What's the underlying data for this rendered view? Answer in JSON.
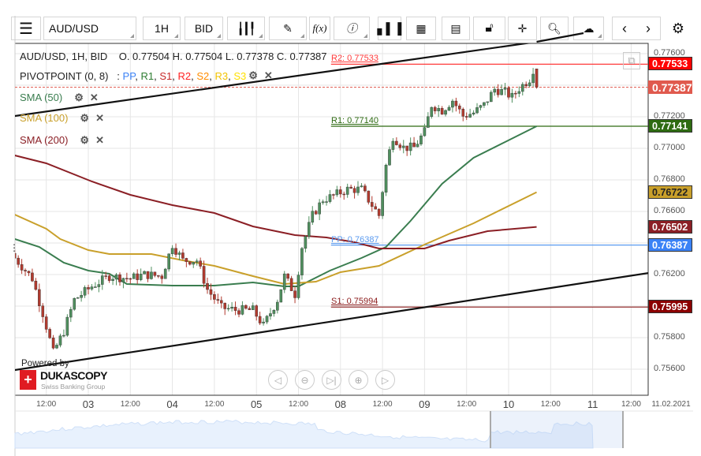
{
  "toolbar": {
    "instrument": "AUD/USD",
    "timeframe": "1H",
    "price_side": "BID",
    "items": [
      "menu-icon",
      "candlestick-icon",
      "pencil-icon",
      "function-icon",
      "info-icon",
      "bar-chart-icon",
      "calendar-icon",
      "report-icon",
      "lock-icon",
      "crosshair-icon",
      "zoom-icon",
      "cloud-upload-icon",
      "chevron-left-icon",
      "chevron-right-icon",
      "gear-icon"
    ],
    "fx_label": "f(x)"
  },
  "legend": {
    "header": "AUD/USD, 1H, BID",
    "ohlc": "O. 0.77504 H. 0.77504 L. 0.77378 C. 0.77387",
    "pivot": "PIVOTPOINT (0, 8)",
    "pivot_sep": ":",
    "pivot_parts": [
      {
        "label": "PP",
        "color": "#3b82f6"
      },
      {
        "label": "R1",
        "color": "#2e7d32"
      },
      {
        "label": "S1",
        "color": "#c62828"
      },
      {
        "label": "R2",
        "color": "#ff2222"
      },
      {
        "label": "S2",
        "color": "#ff8c00"
      },
      {
        "label": "R3",
        "color": "#f2c200"
      },
      {
        "label": "S3",
        "color": "#ffe000"
      }
    ],
    "sma": [
      {
        "label": "SMA (50)",
        "color": "#3a7d4f"
      },
      {
        "label": "SMA (100)",
        "color": "#c9a02b"
      },
      {
        "label": "SMA (200)",
        "color": "#8b1f25"
      }
    ]
  },
  "chart_data": {
    "type": "candlestick",
    "last_candle": {
      "time": "10 08:00",
      "open": 0.77504,
      "high": 0.77504,
      "low": 0.77378,
      "close": 0.77387
    },
    "price_path": [
      [
        "02 03:00",
        0.76305
      ],
      [
        "02 08:00",
        0.76175
      ],
      [
        "02 11:00",
        0.75955
      ],
      [
        "02 14:00",
        0.75705
      ],
      [
        "02 17:00",
        0.7584
      ],
      [
        "02 20:00",
        0.7604
      ],
      [
        "03 01:00",
        0.76125
      ],
      [
        "03 06:00",
        0.7619
      ],
      [
        "03 12:00",
        0.76175
      ],
      [
        "03 16:00",
        0.762
      ],
      [
        "03 21:00",
        0.7619
      ],
      [
        "04 00:00",
        0.7639
      ],
      [
        "04 03:00",
        0.7629
      ],
      [
        "04 07:00",
        0.7629
      ],
      [
        "04 10:00",
        0.76105
      ],
      [
        "04 14:00",
        0.7599
      ],
      [
        "04 18:00",
        0.75975
      ],
      [
        "04 23:00",
        0.75975
      ],
      [
        "05 02:00",
        0.75875
      ],
      [
        "05 06:00",
        0.7604
      ],
      [
        "05 08:00",
        0.7619
      ],
      [
        "05 11:00",
        0.76075
      ],
      [
        "05 13:00",
        0.76375
      ],
      [
        "05 16:00",
        0.76575
      ],
      [
        "05 19:00",
        0.76675
      ],
      [
        "05 21:00",
        0.7669
      ],
      [
        "08 02:00",
        0.7674
      ],
      [
        "08 06:00",
        0.7674
      ],
      [
        "08 09:00",
        0.7664
      ],
      [
        "08 11:00",
        0.76575
      ],
      [
        "08 13:00",
        0.7689
      ],
      [
        "08 15:00",
        0.77075
      ],
      [
        "08 18:00",
        0.77005
      ],
      [
        "08 21:00",
        0.77005
      ],
      [
        "09 00:00",
        0.77105
      ],
      [
        "09 02:00",
        0.77275
      ],
      [
        "09 05:00",
        0.7724
      ],
      [
        "09 08:00",
        0.77305
      ],
      [
        "09 11:00",
        0.77205
      ],
      [
        "09 14:00",
        0.77225
      ],
      [
        "09 17:00",
        0.77275
      ],
      [
        "09 20:00",
        0.77375
      ],
      [
        "09 23:00",
        0.77355
      ],
      [
        "10 01:00",
        0.77325
      ],
      [
        "10 03:00",
        0.7738
      ],
      [
        "10 06:00",
        0.7744
      ],
      [
        "10 07:00",
        0.775
      ]
    ],
    "sma": [
      {
        "name": "SMA (50)",
        "color": "#3a7d4f",
        "points": [
          [
            "02 03:00",
            0.76425
          ],
          [
            "02 10:00",
            0.76375
          ],
          [
            "02 17:00",
            0.76275
          ],
          [
            "03 00:00",
            0.76225
          ],
          [
            "03 06:00",
            0.76205
          ],
          [
            "03 11:00",
            0.7614
          ],
          [
            "04 00:00",
            0.7613
          ],
          [
            "04 12:00",
            0.7613
          ],
          [
            "04 23:00",
            0.7615
          ],
          [
            "05 08:00",
            0.76125
          ],
          [
            "05 12:00",
            0.76125
          ],
          [
            "05 21:00",
            0.76225
          ],
          [
            "08 06:00",
            0.76305
          ],
          [
            "08 13:00",
            0.76375
          ],
          [
            "08 20:00",
            0.7654
          ],
          [
            "09 05:00",
            0.76775
          ],
          [
            "09 14:00",
            0.7694
          ],
          [
            "09 23:00",
            0.7704
          ],
          [
            "10 08:00",
            0.7714
          ]
        ]
      },
      {
        "name": "SMA (100)",
        "color": "#c9a02b",
        "points": [
          [
            "02 03:00",
            0.7658
          ],
          [
            "02 12:00",
            0.7649
          ],
          [
            "02 16:00",
            0.76425
          ],
          [
            "03 00:00",
            0.76355
          ],
          [
            "03 06:00",
            0.7633
          ],
          [
            "03 18:00",
            0.7633
          ],
          [
            "04 03:00",
            0.7629
          ],
          [
            "04 12:00",
            0.76255
          ],
          [
            "04 23:00",
            0.7619
          ],
          [
            "05 08:00",
            0.7614
          ],
          [
            "05 17:00",
            0.76155
          ],
          [
            "08 00:00",
            0.76215
          ],
          [
            "08 11:00",
            0.76255
          ],
          [
            "09 00:00",
            0.7639
          ],
          [
            "09 14:00",
            0.76525
          ],
          [
            "10 08:00",
            0.76722
          ]
        ]
      },
      {
        "name": "SMA (200)",
        "color": "#8b1f25",
        "points": [
          [
            "02 03:00",
            0.76955
          ],
          [
            "02 12:00",
            0.76905
          ],
          [
            "03 01:00",
            0.7679
          ],
          [
            "03 12:00",
            0.76705
          ],
          [
            "04 00:00",
            0.7664
          ],
          [
            "04 12:00",
            0.7659
          ],
          [
            "04 23:00",
            0.76505
          ],
          [
            "05 11:00",
            0.7645
          ],
          [
            "05 20:00",
            0.76435
          ],
          [
            "08 04:00",
            0.76405
          ],
          [
            "08 11:00",
            0.76365
          ],
          [
            "09 00:00",
            0.76365
          ],
          [
            "09 07:00",
            0.76415
          ],
          [
            "09 18:00",
            0.76475
          ],
          [
            "10 08:00",
            0.76502
          ]
        ]
      }
    ],
    "trendlines": [
      {
        "from": [
          "02 03:00",
          0.77205
        ],
        "to": [
          "10 08:00",
          0.77675
        ],
        "color": "#111111"
      },
      {
        "from": [
          "02 03:00",
          0.75595
        ],
        "to": [
          "11 16:00",
          0.7621
        ],
        "color": "#111111"
      }
    ],
    "pivot_levels": [
      {
        "label": "R2: 0.77533",
        "value": 0.77533,
        "color": "#ff3b3b"
      },
      {
        "label": "R1: 0.77140",
        "value": 0.7714,
        "color": "#2e6b12"
      },
      {
        "label": "PP: 0.76387",
        "value": 0.76387,
        "color": "#5b9bf0"
      },
      {
        "label": "S1: 0.75994",
        "value": 0.75994,
        "color": "#8b1a1a"
      }
    ],
    "pivot_start": "08 00:00",
    "y_ticks": [
      "0.77600",
      "0.77400",
      "0.77200",
      "0.77000",
      "0.76800",
      "0.76600",
      "0.76400",
      "0.76200",
      "0.76000",
      "0.75800",
      "0.75600"
    ],
    "x_ticks": [
      {
        "t": "02 12:00",
        "label": "12:00",
        "day": false
      },
      {
        "t": "03 00:00",
        "label": "03",
        "day": true
      },
      {
        "t": "03 12:00",
        "label": "12:00",
        "day": false
      },
      {
        "t": "04 00:00",
        "label": "04",
        "day": true
      },
      {
        "t": "04 12:00",
        "label": "12:00",
        "day": false
      },
      {
        "t": "05 00:00",
        "label": "05",
        "day": true
      },
      {
        "t": "05 12:00",
        "label": "12:00",
        "day": false
      },
      {
        "t": "08 00:00",
        "label": "08",
        "day": true
      },
      {
        "t": "08 12:00",
        "label": "12:00",
        "day": false
      },
      {
        "t": "09 00:00",
        "label": "09",
        "day": true
      },
      {
        "t": "09 12:00",
        "label": "12:00",
        "day": false
      },
      {
        "t": "10 00:00",
        "label": "10",
        "day": true
      },
      {
        "t": "10 12:00",
        "label": "12:00",
        "day": false
      },
      {
        "t": "11 00:00",
        "label": "11",
        "day": true
      },
      {
        "t": "11 11:00",
        "label": "12:00",
        "day": false
      }
    ],
    "x_end_label": "11.02.2021",
    "price_badges": [
      {
        "value": 0.77533,
        "text": "0.77533",
        "bg": "#ff0000",
        "fg": "#ffffff"
      },
      {
        "value": 0.77387,
        "text": "0.77387",
        "bg": "#e05a4e",
        "fg": "#ffffff",
        "current": true
      },
      {
        "value": 0.77141,
        "text": "0.77141",
        "bg": "#2e6b12",
        "fg": "#ffffff"
      },
      {
        "value": 0.76722,
        "text": "0.76722",
        "bg": "#c9a02b",
        "fg": "#222222"
      },
      {
        "value": 0.76502,
        "text": "0.76502",
        "bg": "#8b1f25",
        "fg": "#ffffff"
      },
      {
        "value": 0.76387,
        "text": "0.76387",
        "bg": "#3b82f6",
        "fg": "#ffffff"
      },
      {
        "value": 0.75995,
        "text": "0.75995",
        "bg": "#8b0000",
        "fg": "#ffffff"
      }
    ],
    "up_color": "#4f8f5e",
    "down_color": "#b23a2e"
  },
  "branding": {
    "powered": "Powered by",
    "name": "DUKASCOPY",
    "tagline": "Swiss Banking Group"
  },
  "nav_buttons": [
    "scroll-left",
    "zoom-out",
    "scroll-to-end",
    "zoom-in",
    "scroll-right"
  ]
}
